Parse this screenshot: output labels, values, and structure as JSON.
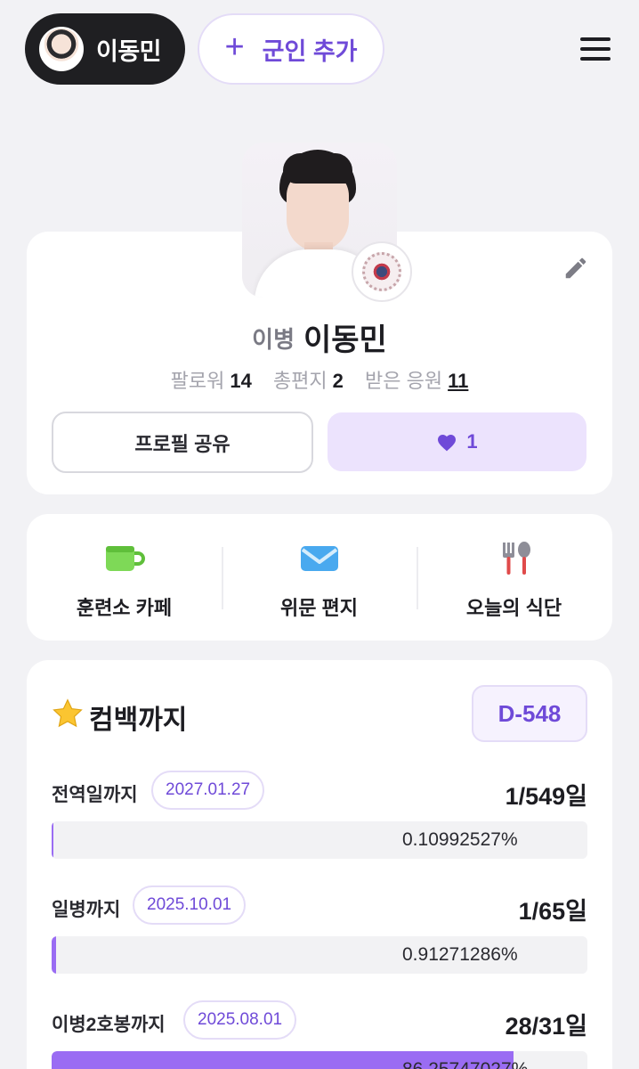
{
  "topbar": {
    "profile_name": "이동민",
    "add_label": "군인 추가"
  },
  "profile": {
    "rank": "이병",
    "name": "이동민",
    "stats": [
      {
        "label": "팔로워",
        "value": "14"
      },
      {
        "label": "총편지",
        "value": "2"
      },
      {
        "label": "받은 응원",
        "value": "11"
      }
    ],
    "share_label": "프로필 공유",
    "cheer_count": "1"
  },
  "quick_menu": [
    {
      "label": "훈련소 카페",
      "icon": "cup-icon"
    },
    {
      "label": "위문 편지",
      "icon": "envelope-icon"
    },
    {
      "label": "오늘의 식단",
      "icon": "utensils-icon"
    }
  ],
  "comeback": {
    "title": "컴백까지",
    "dday": "D-548",
    "rows": [
      {
        "label": "전역일까지",
        "date": "2027.01.27",
        "count": "1/549일",
        "percent_text": "0.10992527%",
        "progress": 0.0011
      },
      {
        "label": "일병까지",
        "date": "2025.10.01",
        "count": "1/65일",
        "percent_text": "0.91271286%",
        "progress": 0.0091
      },
      {
        "label": "이병2호봉까지",
        "date": "2025.08.01",
        "count": "28/31일",
        "percent_text": "86.25747027%",
        "progress": 0.8626
      }
    ]
  },
  "colors": {
    "accent": "#6f4ad8",
    "progress_fill": "#9a6cf3",
    "background": "#f2f2f5"
  }
}
